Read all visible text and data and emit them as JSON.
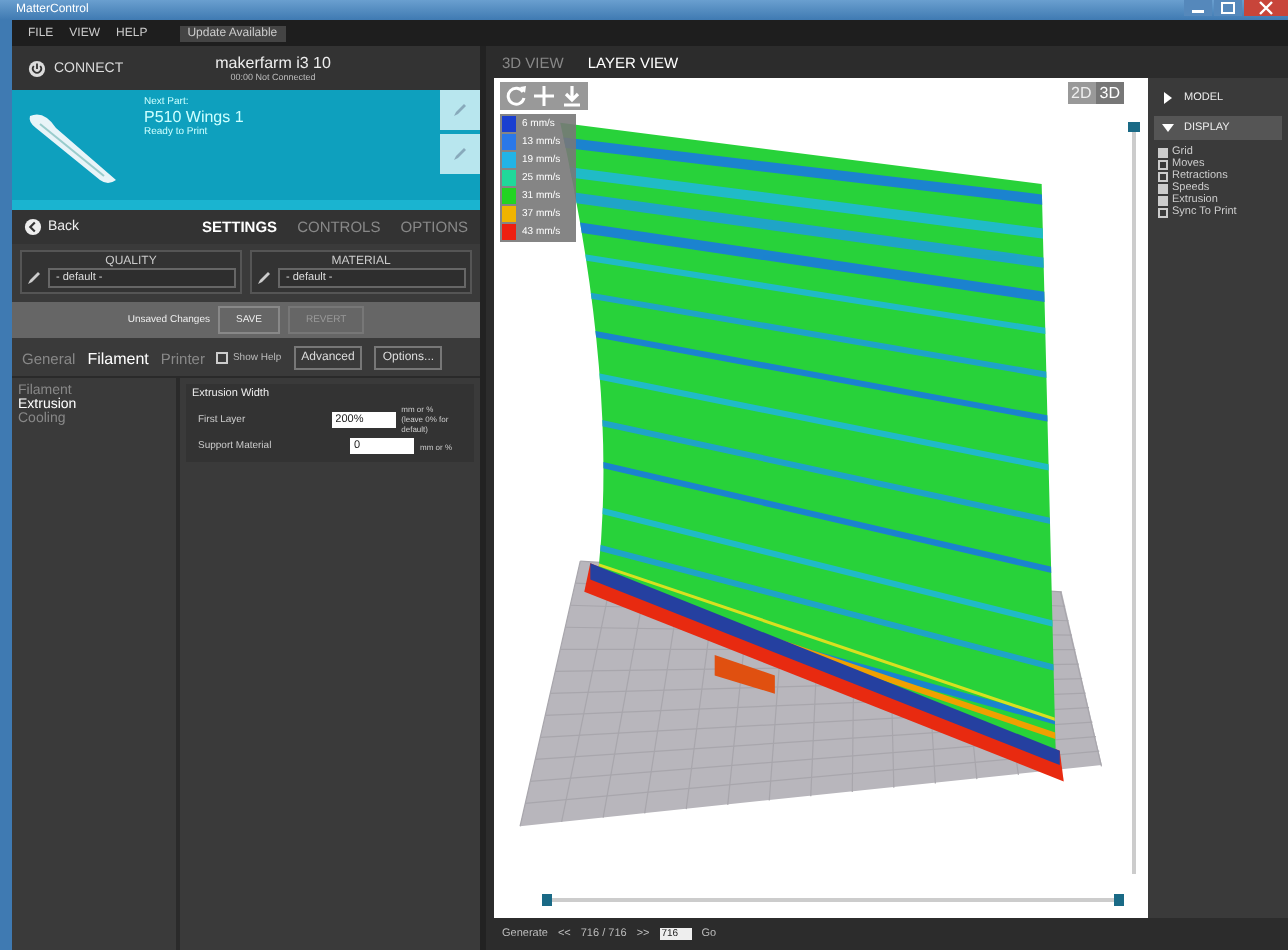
{
  "window": {
    "title": "MatterControl"
  },
  "menu": [
    {
      "label": "FILE"
    },
    {
      "label": "VIEW"
    },
    {
      "label": "HELP"
    }
  ],
  "update_notice": "Update Available",
  "printer_bar": {
    "connect": "CONNECT",
    "printer_name": "makerfarm i3 10",
    "status": "00:00 Not Connected"
  },
  "queue_item": {
    "caption": "Next Part:",
    "name": "P510 Wings 1",
    "status": "Ready to Print"
  },
  "nav": {
    "back": "Back",
    "tabs": [
      {
        "label": "SETTINGS",
        "selected": true
      },
      {
        "label": "CONTROLS",
        "selected": false
      },
      {
        "label": "OPTIONS",
        "selected": false
      }
    ]
  },
  "presets": [
    {
      "title": "QUALITY",
      "value": "- default -"
    },
    {
      "title": "MATERIAL",
      "value": "- default -"
    }
  ],
  "unsaved": {
    "label": "Unsaved Changes",
    "buttons": [
      {
        "label": "SAVE",
        "disabled": false
      },
      {
        "label": "REVERT",
        "disabled": true
      }
    ]
  },
  "settings_tabs": [
    {
      "label": "General",
      "selected": false
    },
    {
      "label": "Filament",
      "selected": true
    },
    {
      "label": "Printer",
      "selected": false
    }
  ],
  "show_help": {
    "label": "Show Help",
    "checked": false
  },
  "mode_buttons": [
    {
      "label": "Advanced"
    },
    {
      "label": "Options..."
    }
  ],
  "categories": [
    {
      "label": "Filament",
      "selected": false
    },
    {
      "label": "Extrusion",
      "selected": true
    },
    {
      "label": "Cooling",
      "selected": false
    }
  ],
  "group": {
    "title": "Extrusion Width",
    "fields": [
      {
        "label": "First Layer",
        "value": "200%",
        "unit": "mm or %",
        "note": "(leave 0% for default)"
      },
      {
        "label": "Support Material",
        "value": "0",
        "unit": "mm or %"
      }
    ]
  },
  "view_tabs": [
    {
      "label": "3D VIEW",
      "selected": false
    },
    {
      "label": "LAYER VIEW",
      "selected": true
    }
  ],
  "view_mode": [
    {
      "label": "2D",
      "selected": false
    },
    {
      "label": "3D",
      "selected": true
    }
  ],
  "legend": [
    {
      "label": "6 mm/s",
      "color": "#1a3fd0"
    },
    {
      "label": "13 mm/s",
      "color": "#2a78e8"
    },
    {
      "label": "19 mm/s",
      "color": "#22b4e6"
    },
    {
      "label": "25 mm/s",
      "color": "#20d89a"
    },
    {
      "label": "31 mm/s",
      "color": "#22d422"
    },
    {
      "label": "37 mm/s",
      "color": "#f0b400"
    },
    {
      "label": "43 mm/s",
      "color": "#ee2010"
    }
  ],
  "layer_slider": {
    "level": 1
  },
  "layer_range": {
    "handles": [
      {
        "level": 0
      },
      {
        "level": 1
      }
    ]
  },
  "sidebar": {
    "sections": [
      {
        "label": "MODEL",
        "expanded": false
      },
      {
        "label": "DISPLAY",
        "expanded": true
      }
    ],
    "options": [
      {
        "label": "Grid",
        "checked": true
      },
      {
        "label": "Moves",
        "checked": false
      },
      {
        "label": "Retractions",
        "checked": false
      },
      {
        "label": "Speeds",
        "checked": true
      },
      {
        "label": "Extrusion",
        "checked": true
      },
      {
        "label": "Sync To Print",
        "checked": false
      }
    ]
  },
  "footer": {
    "generate": "Generate",
    "prev": "<<",
    "layer": "716 / 716",
    "next": ">>",
    "input": "716",
    "go": "Go"
  }
}
